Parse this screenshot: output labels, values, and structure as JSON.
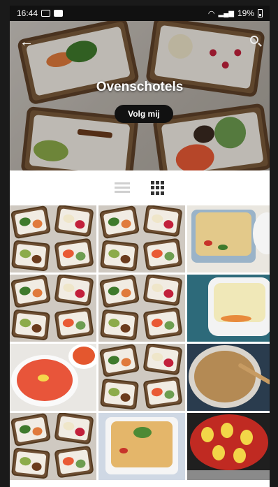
{
  "status_bar": {
    "time": "16:44",
    "battery": "19%"
  },
  "header": {
    "title": "Ovenschotels",
    "follow_label": "Volg mij",
    "back_icon": "arrow-left-icon",
    "search_icon": "search-icon"
  },
  "view_toggle": {
    "list_icon": "list-view-icon",
    "grid_icon": "grid-view-icon",
    "active": "grid"
  },
  "colors": {
    "follow_button": "#111111",
    "status_bar": "#111111",
    "grid_icon_active": "#333333",
    "list_icon_inactive": "#cfcfcf"
  },
  "recipes": [
    {
      "kind": "collage"
    },
    {
      "kind": "collage"
    },
    {
      "kind": "casserole"
    },
    {
      "kind": "collage"
    },
    {
      "kind": "collage"
    },
    {
      "kind": "shepherds-pie"
    },
    {
      "kind": "tomato-dish"
    },
    {
      "kind": "collage"
    },
    {
      "kind": "crumble"
    },
    {
      "kind": "collage"
    },
    {
      "kind": "pasta-bake"
    },
    {
      "kind": "stuffed-peppers"
    }
  ]
}
